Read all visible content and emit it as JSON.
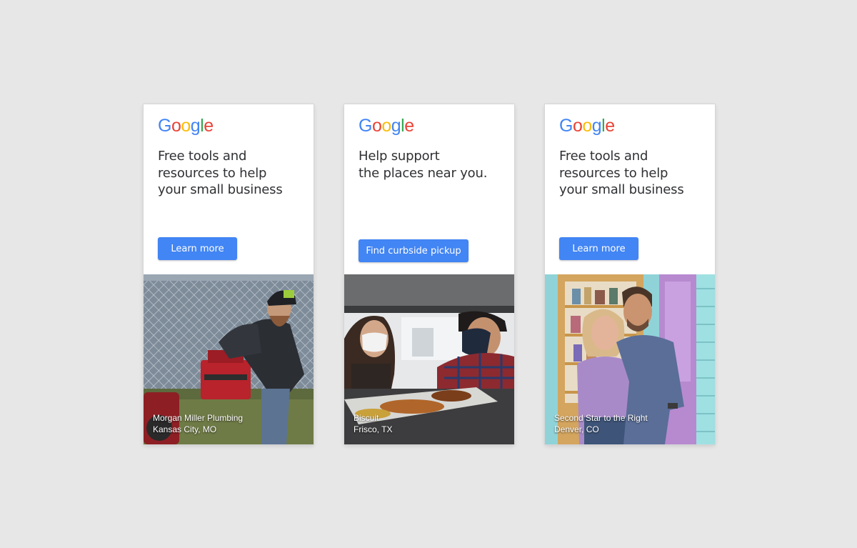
{
  "brand": {
    "logo_letters": [
      "G",
      "o",
      "o",
      "g",
      "l",
      "e"
    ],
    "logo_colors": [
      "#4285f4",
      "#ea4335",
      "#fbbc05",
      "#4285f4",
      "#34a853",
      "#ea4335"
    ],
    "button_color": "#4285f4"
  },
  "ads": [
    {
      "headline": "Free tools and\nresources to help\nyour small business",
      "cta_label": "Learn more",
      "business_name": "Morgan Miller Plumbing",
      "location": "Kansas City, MO"
    },
    {
      "headline": "Help support\nthe places near you.",
      "cta_label": "Find curbside pickup",
      "business_name": "Biscuit",
      "location": "Frisco, TX"
    },
    {
      "headline": "Free tools and\nresources to help\nyour small business",
      "cta_label": "Learn more",
      "business_name": "Second Star to the Right",
      "location": "Denver, CO"
    }
  ]
}
